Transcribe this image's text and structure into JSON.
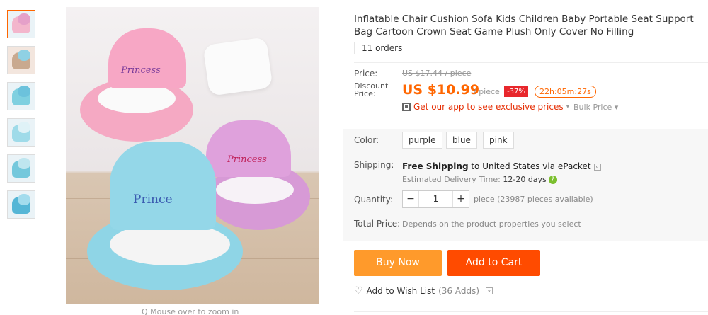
{
  "gallery": {
    "thumbnails": [
      "thumb-1",
      "thumb-2",
      "thumb-3",
      "thumb-4",
      "thumb-5",
      "thumb-6"
    ],
    "zoom_hint": "Q Mouse over to zoom in",
    "image_labels": {
      "crown_pink": "Princess",
      "crown_purple": "Princess",
      "crown_blue": "Prince"
    }
  },
  "product": {
    "title": "Inflatable Chair Cushion Sofa Kids Children Baby Portable Seat Support Bag Cartoon Crown Seat Game Plush Only Cover No Filling",
    "orders": "11 orders"
  },
  "price": {
    "price_label": "Price:",
    "original": "US $17.44 / piece",
    "discount_label": "Discount Price:",
    "discounted": "US $10.99",
    "per_piece": "/ piece",
    "discount_badge": "-37%",
    "countdown": "22h:05m:27s",
    "app_promo": "Get our app to see exclusive prices",
    "app_promo_chevron": "▾",
    "bulk_price": "Bulk Price ▾"
  },
  "options": {
    "color_label": "Color:",
    "colors": [
      "purple",
      "blue",
      "pink"
    ],
    "shipping_label": "Shipping:",
    "shipping_main": "Free Shipping",
    "shipping_dest": " to United States via ePacket",
    "delivery_label": "Estimated Delivery Time:",
    "delivery_value": "12-20 days",
    "quantity_label": "Quantity:",
    "quantity_value": "1",
    "qty_minus": "−",
    "qty_plus": "+",
    "availability": "piece (23987 pieces available)",
    "total_label": "Total Price:",
    "total_value": "Depends on the product properties you select"
  },
  "actions": {
    "buy_now": "Buy Now",
    "add_to_cart": "Add to Cart",
    "wishlist": "Add to Wish List",
    "wish_count": "(36 Adds)"
  },
  "colors": {
    "accent": "#ff6600",
    "buy_now": "#ff9a2b",
    "add_cart": "#ff4b00",
    "discount_badge": "#e8272c",
    "promo": "#e62e04"
  },
  "icons": {
    "qr": "qr-code-icon",
    "help": "question-icon",
    "heart": "heart-plus-icon",
    "chevron": "chevron-down-icon"
  }
}
